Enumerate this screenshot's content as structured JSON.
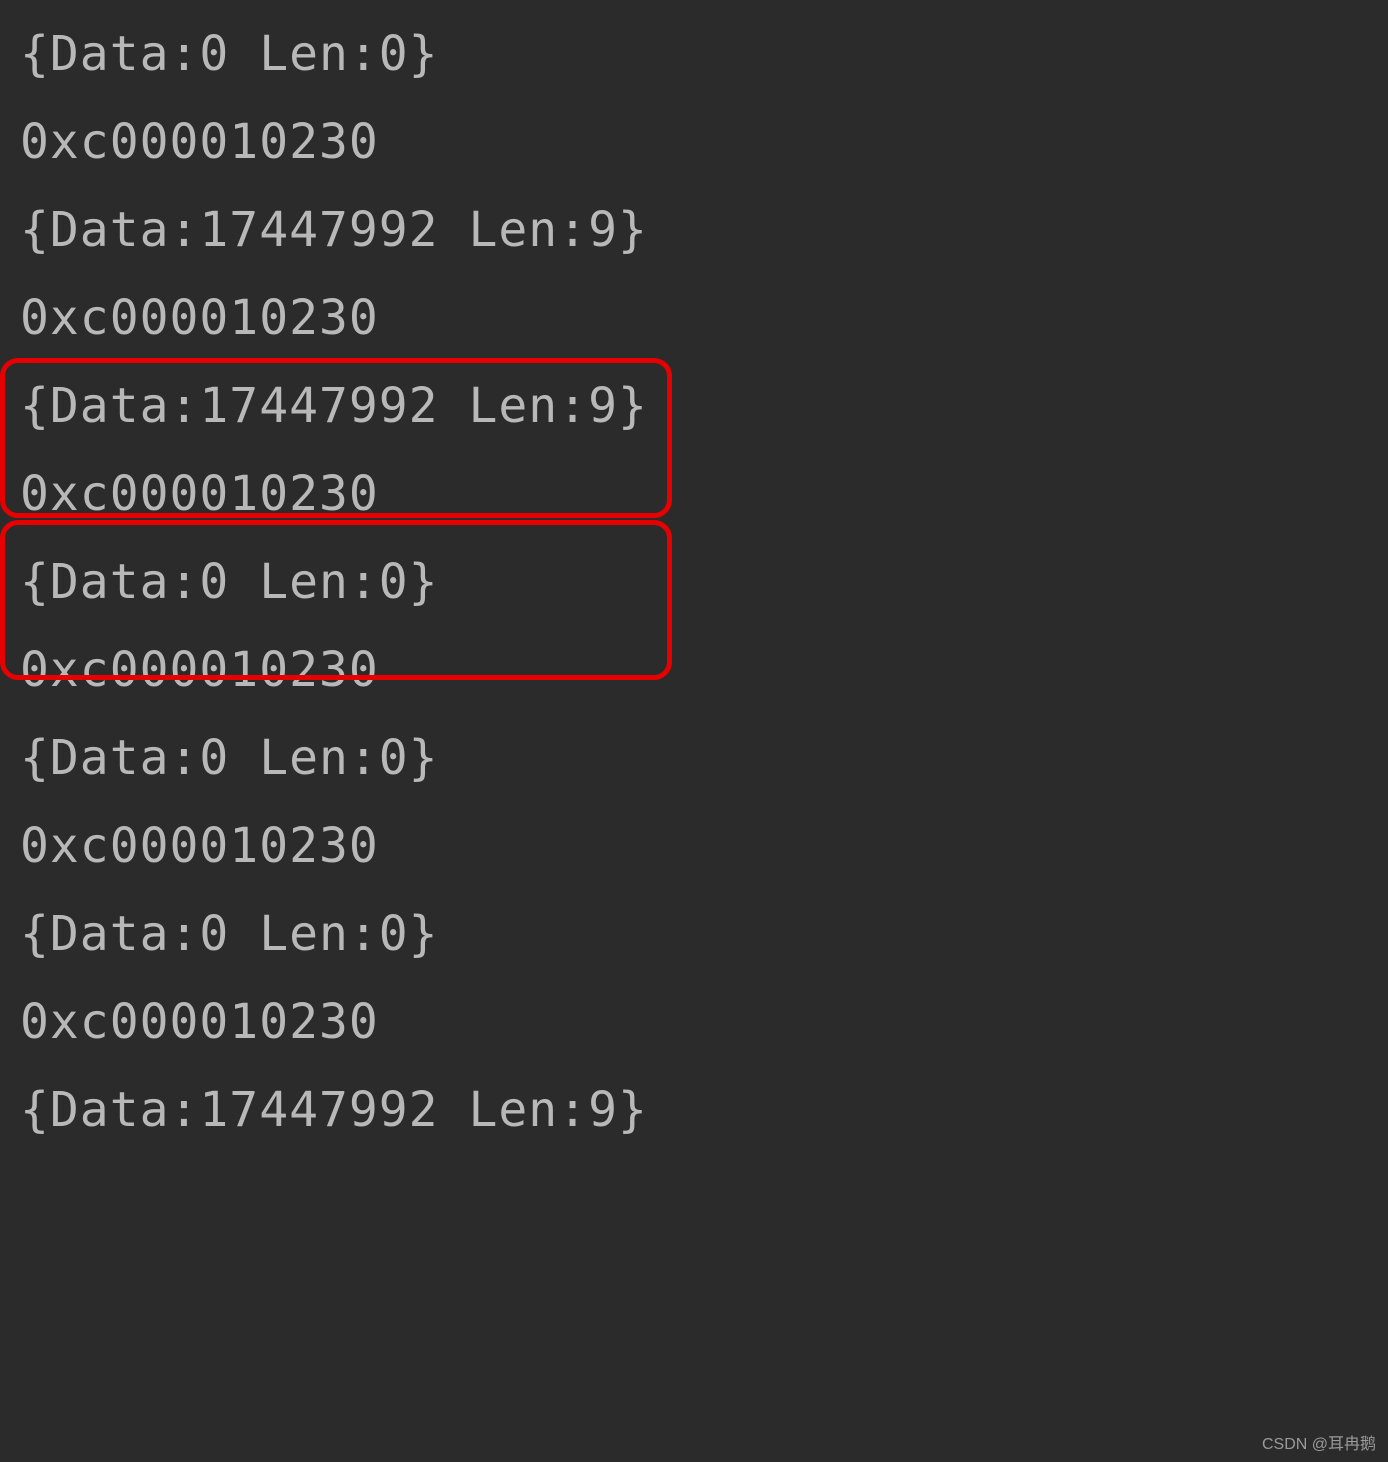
{
  "lines": [
    "{Data:0 Len:0}",
    "0xc000010230",
    "{Data:17447992 Len:9}",
    "0xc000010230",
    "{Data:17447992 Len:9}",
    "0xc000010230",
    "{Data:0 Len:0}",
    "0xc000010230",
    "{Data:0 Len:0}",
    "0xc000010230",
    "{Data:0 Len:0}",
    "0xc000010230",
    "{Data:17447992 Len:9}"
  ],
  "watermark": "CSDN @耳冉鹅"
}
